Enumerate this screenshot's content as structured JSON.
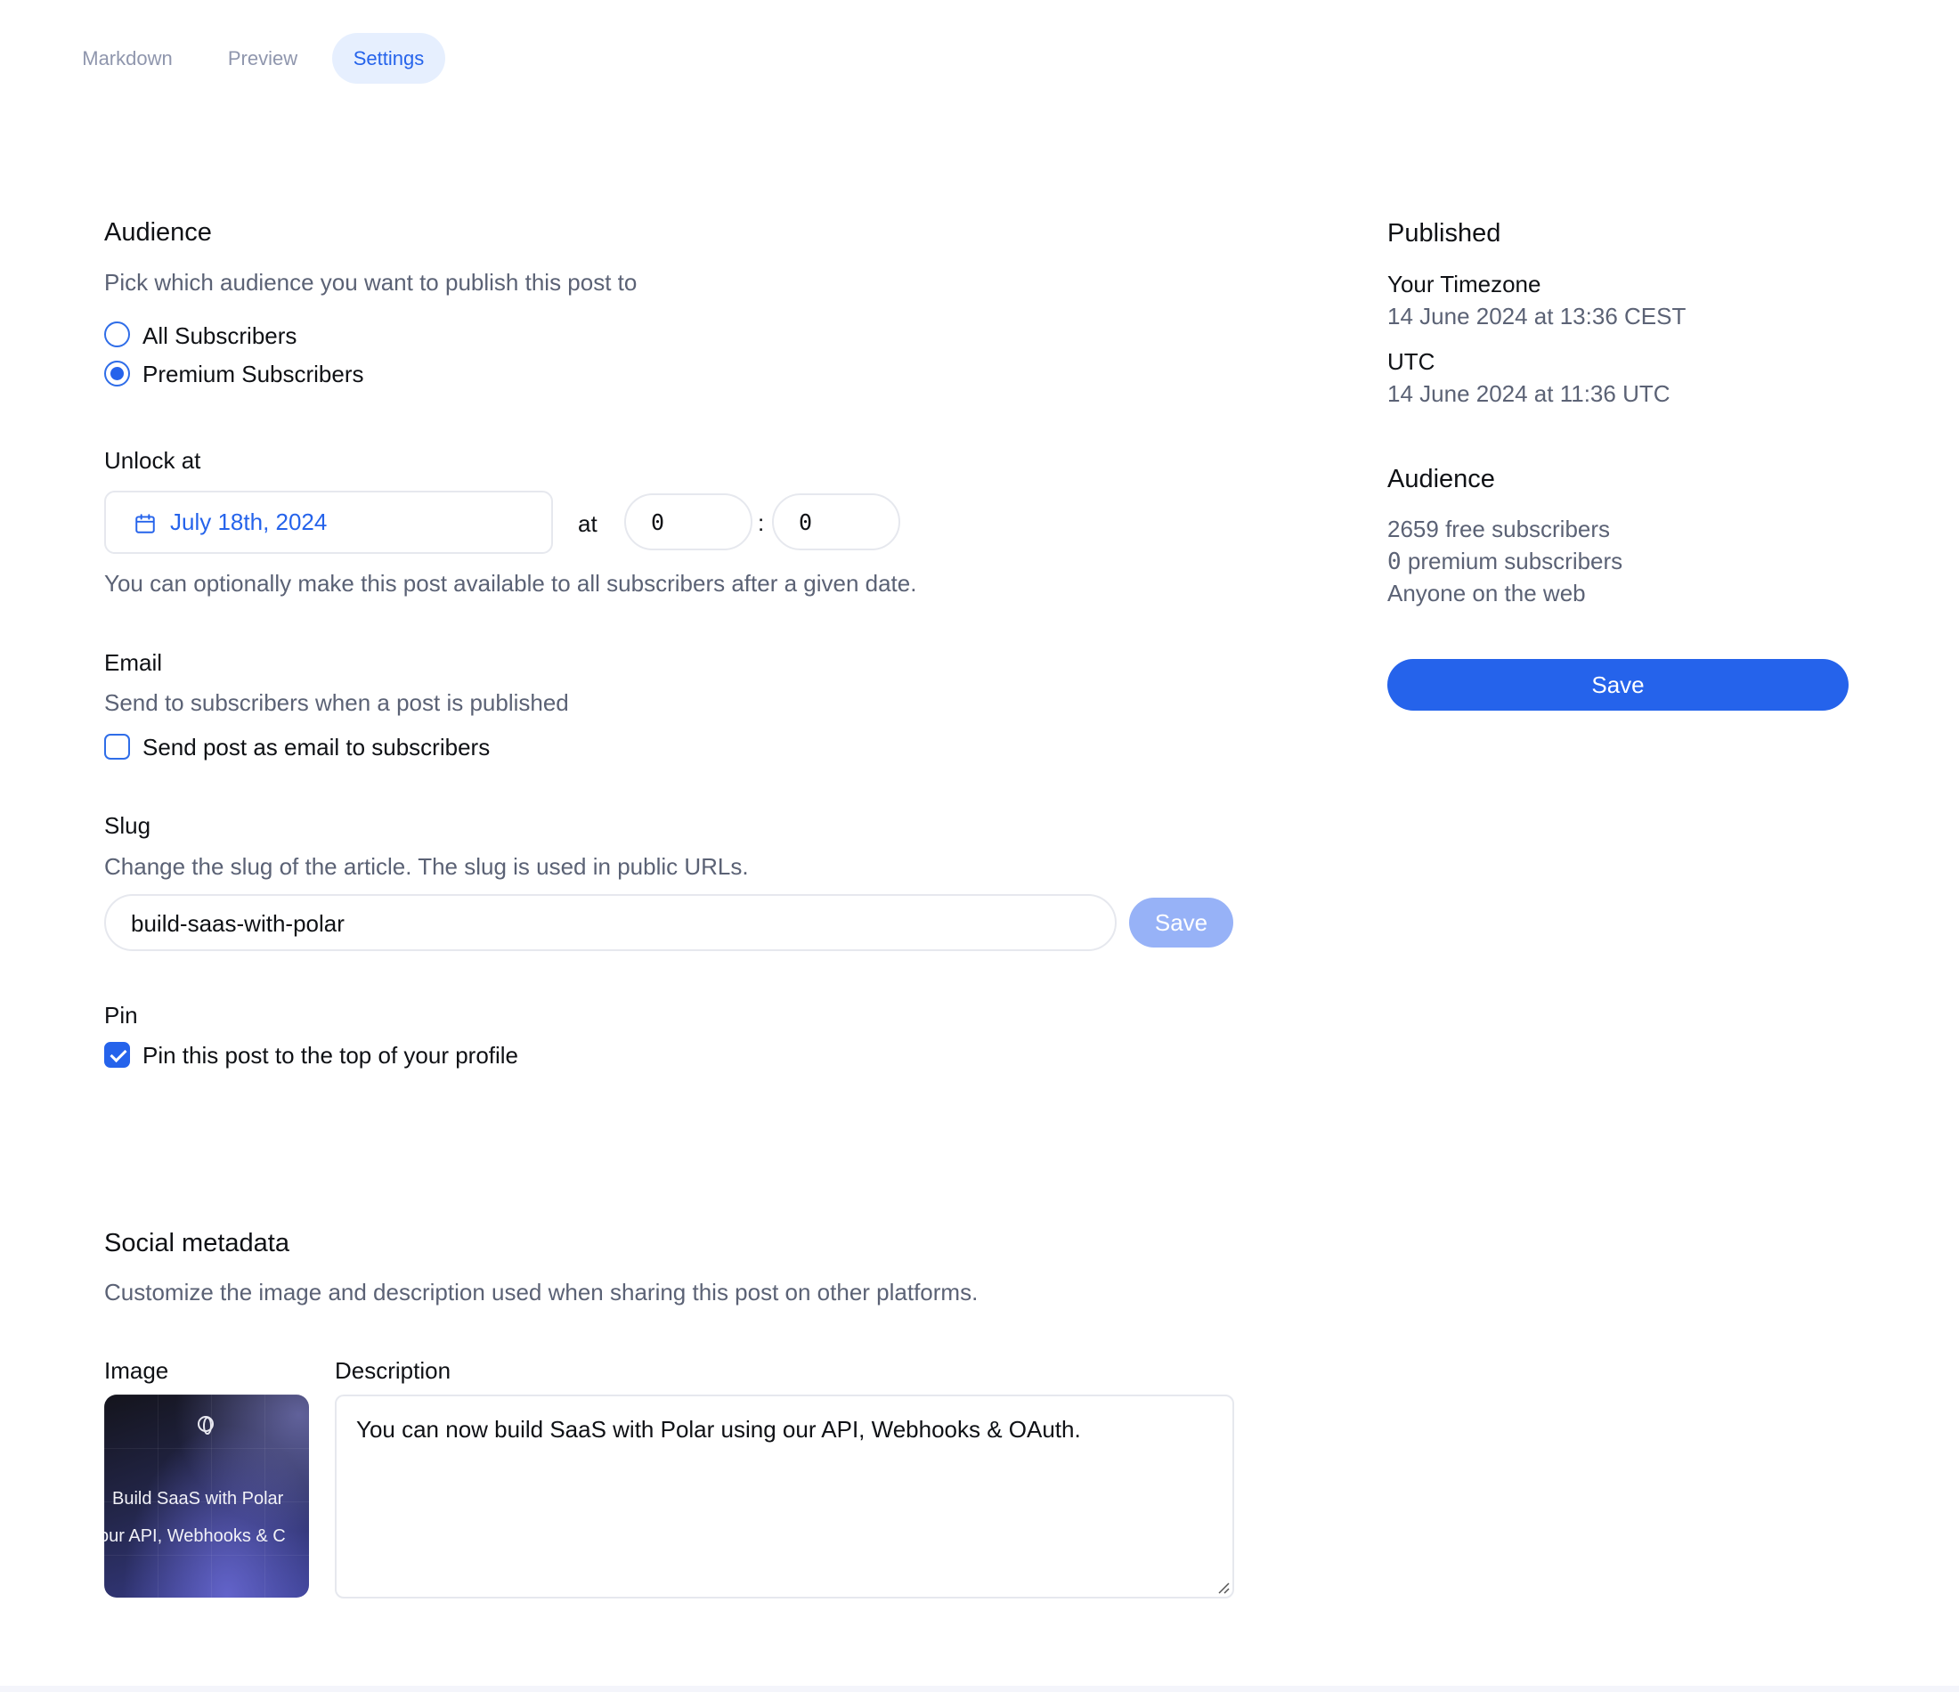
{
  "tabs": [
    {
      "label": "Markdown"
    },
    {
      "label": "Preview"
    },
    {
      "label": "Settings"
    }
  ],
  "audience": {
    "title": "Audience",
    "description": "Pick which audience you want to publish this post to",
    "options": [
      {
        "label": "All Subscribers",
        "selected": false
      },
      {
        "label": "Premium Subscribers",
        "selected": true
      }
    ]
  },
  "unlock": {
    "label": "Unlock at",
    "date": "July 18th, 2024",
    "at_label": "at",
    "hour": "0",
    "separator": ":",
    "minute": "0",
    "help": "You can optionally make this post available to all subscribers after a given date."
  },
  "email": {
    "label": "Email",
    "description": "Send to subscribers when a post is published",
    "checkbox_label": "Send post as email to subscribers",
    "checked": false
  },
  "slug": {
    "label": "Slug",
    "description": "Change the slug of the article. The slug is used in public URLs.",
    "value": "build-saas-with-polar",
    "save_label": "Save"
  },
  "pin": {
    "label": "Pin",
    "checkbox_label": "Pin this post to the top of your profile",
    "checked": true
  },
  "social": {
    "title": "Social metadata",
    "description": "Customize the image and description used when sharing this post on other platforms.",
    "image_label": "Image",
    "description_label": "Description",
    "card_line1": "Build SaaS with Polar",
    "card_line2": "our API, Webhooks & C",
    "description_value": "You can now build SaaS with Polar using our API, Webhooks & OAuth."
  },
  "sidebar": {
    "published_title": "Published",
    "your_timezone_label": "Your Timezone",
    "your_timezone_value": "14 June 2024 at 13:36 CEST",
    "utc_label": "UTC",
    "utc_value": "14 June 2024 at 11:36 UTC",
    "audience_title": "Audience",
    "free_count": "2659",
    "free_label": "free subscribers",
    "premium_count": "0",
    "premium_label": "premium subscribers",
    "web_label": "Anyone on the web",
    "save_label": "Save"
  },
  "colors": {
    "accent": "#2563eb",
    "accent_light": "#e6effe",
    "disabled_button": "#97b2f7",
    "muted_text": "#5b6275"
  },
  "icons": {
    "date": "calendar-icon",
    "logo": "polar-logo-icon",
    "resize": "resize-handle-icon"
  }
}
